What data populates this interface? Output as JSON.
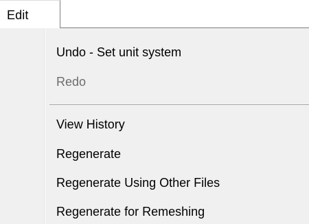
{
  "menubar": {
    "edit_label": "Edit"
  },
  "edit_menu": {
    "items": [
      {
        "label": "Undo - Set unit system",
        "enabled": true
      },
      {
        "label": "Redo",
        "enabled": false
      },
      {
        "label": "View History",
        "enabled": true
      },
      {
        "label": "Regenerate",
        "enabled": true
      },
      {
        "label": "Regenerate Using Other Files",
        "enabled": true
      },
      {
        "label": "Regenerate for Remeshing",
        "enabled": true
      }
    ]
  },
  "colors": {
    "menu_background": "#f0f0f0",
    "disabled_text": "#6d6d6d",
    "separator": "#a0a0a0"
  }
}
